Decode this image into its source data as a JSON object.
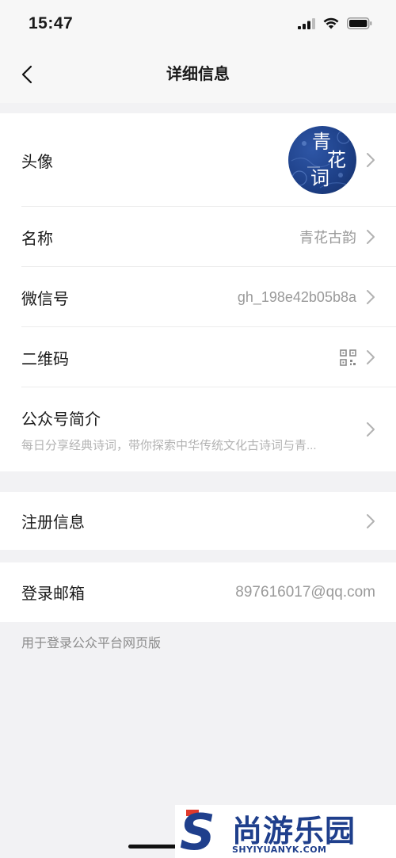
{
  "status_bar": {
    "time": "15:47"
  },
  "nav": {
    "title": "详细信息"
  },
  "profile": {
    "avatar_label": "头像",
    "avatar_chars": [
      "青",
      "花",
      "词"
    ],
    "name_label": "名称",
    "name_value": "青花古韵",
    "wechat_id_label": "微信号",
    "wechat_id_value": "gh_198e42b05b8a",
    "qrcode_label": "二维码",
    "intro_label": "公众号简介",
    "intro_value": "每日分享经典诗词，带你探索中华传统文化古诗词与青..."
  },
  "registration": {
    "label": "注册信息"
  },
  "login": {
    "label": "登录邮箱",
    "value": "897616017@qq.com",
    "note": "用于登录公众平台网页版"
  },
  "watermark": {
    "brand_cn": "尚游乐园",
    "brand_en": "SHYIYUANYK.COM"
  },
  "colors": {
    "background": "#f2f2f4",
    "avatar_blue": "#1d3f86",
    "watermark_blue": "#1f3f8c"
  }
}
